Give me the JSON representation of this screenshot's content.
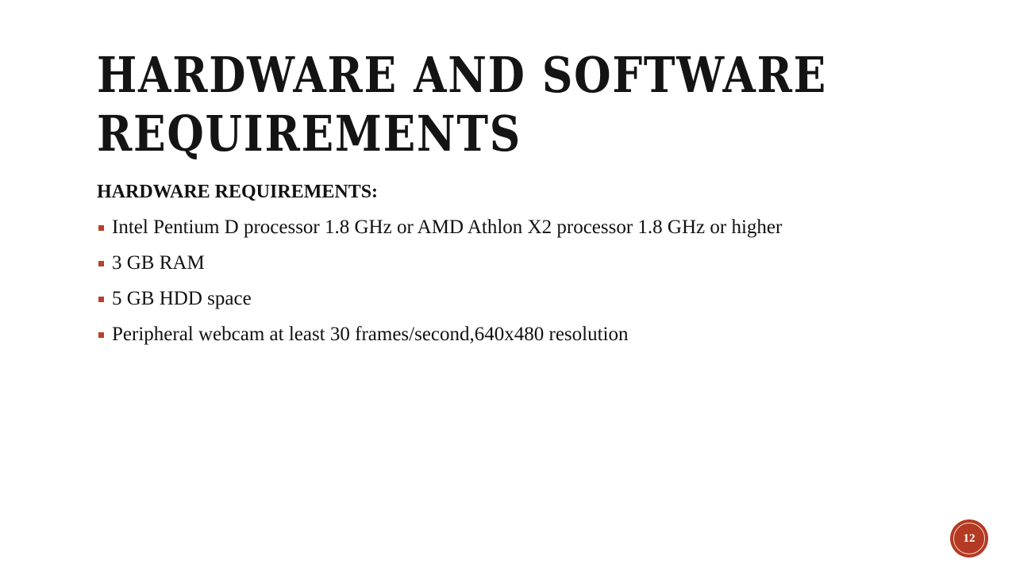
{
  "slide": {
    "title_lines": [
      "Hardware and Software",
      "Requirements"
    ],
    "subheading": "HARDWARE REQUIREMENTS:",
    "bullets": [
      "Intel Pentium D processor 1.8 GHz or AMD Athlon X2 processor 1.8 GHz or higher",
      "3 GB RAM",
      "5 GB HDD space",
      "Peripheral webcam at least 30 frames/second,640x480 resolution"
    ],
    "page_number": "12"
  },
  "colors": {
    "accent": "#b43a23",
    "title_text": "#141414",
    "body_text": "#111111",
    "background": "#ffffff"
  }
}
